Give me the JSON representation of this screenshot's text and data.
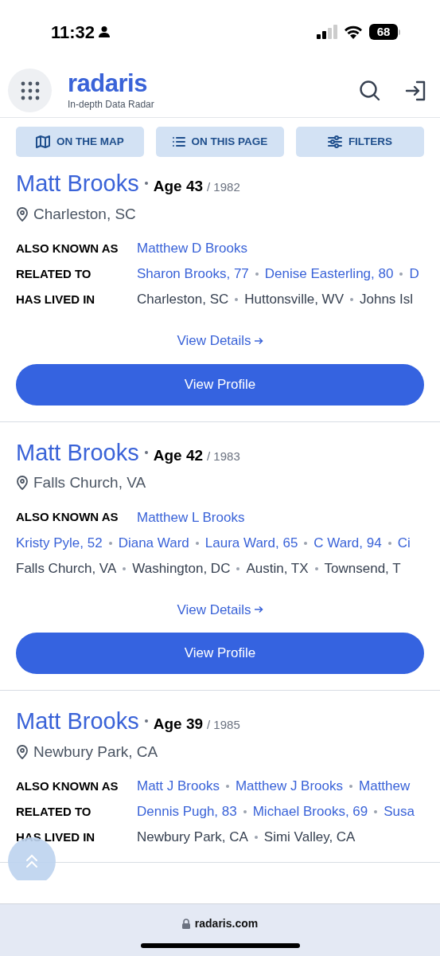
{
  "status_bar": {
    "time": "11:32",
    "battery": "68"
  },
  "header": {
    "logo": "radaris",
    "tagline": "In-depth Data Radar"
  },
  "toolbar": [
    {
      "kind": "map",
      "label": "ON THE MAP"
    },
    {
      "kind": "list",
      "label": "ON THIS PAGE"
    },
    {
      "kind": "filters",
      "label": "FILTERS"
    }
  ],
  "results": [
    {
      "name": "Matt Brooks",
      "age": "Age 43",
      "year": "/ 1982",
      "location": "Charleston, SC",
      "rows": [
        {
          "label": "ALSO KNOWN AS",
          "kind": "link",
          "items": [
            "Matthew D Brooks"
          ]
        },
        {
          "label": "RELATED TO",
          "kind": "link",
          "items": [
            "Sharon Brooks, 77",
            "Denise Easterling, 80",
            "D"
          ]
        },
        {
          "label": "HAS LIVED IN",
          "kind": "plain",
          "items": [
            "Charleston, SC",
            "Huttonsville, WV",
            "Johns Isl"
          ]
        }
      ],
      "details": "View Details",
      "profile": "View Profile"
    },
    {
      "name": "Matt Brooks",
      "age": "Age 42",
      "year": "/ 1983",
      "location": "Falls Church, VA",
      "rows": [
        {
          "label": "ALSO KNOWN AS",
          "kind": "link",
          "items": [
            "Matthew L Brooks"
          ]
        },
        {
          "kind": "link",
          "items": [
            "Kristy Pyle, 52",
            "Diana Ward",
            "Laura Ward, 65",
            "C Ward, 94",
            "Ci"
          ]
        },
        {
          "kind": "plain",
          "items": [
            "Falls Church, VA",
            "Washington, DC",
            "Austin, TX",
            "Townsend, T"
          ]
        }
      ],
      "details": "View Details",
      "profile": "View Profile"
    },
    {
      "name": "Matt Brooks",
      "age": "Age 39",
      "year": "/ 1985",
      "location": "Newbury Park, CA",
      "rows": [
        {
          "label": "ALSO KNOWN AS",
          "kind": "link",
          "items": [
            "Matt J Brooks",
            "Matthew J Brooks",
            "Matthew"
          ]
        },
        {
          "label": "RELATED TO",
          "kind": "link",
          "items": [
            "Dennis Pugh, 83",
            "Michael Brooks, 69",
            "Susa"
          ]
        },
        {
          "label": "HAS LIVED IN",
          "kind": "plain",
          "items": [
            "Newbury Park, CA",
            "Simi Valley, CA"
          ]
        }
      ]
    }
  ],
  "browser": {
    "url": "radaris.com"
  }
}
